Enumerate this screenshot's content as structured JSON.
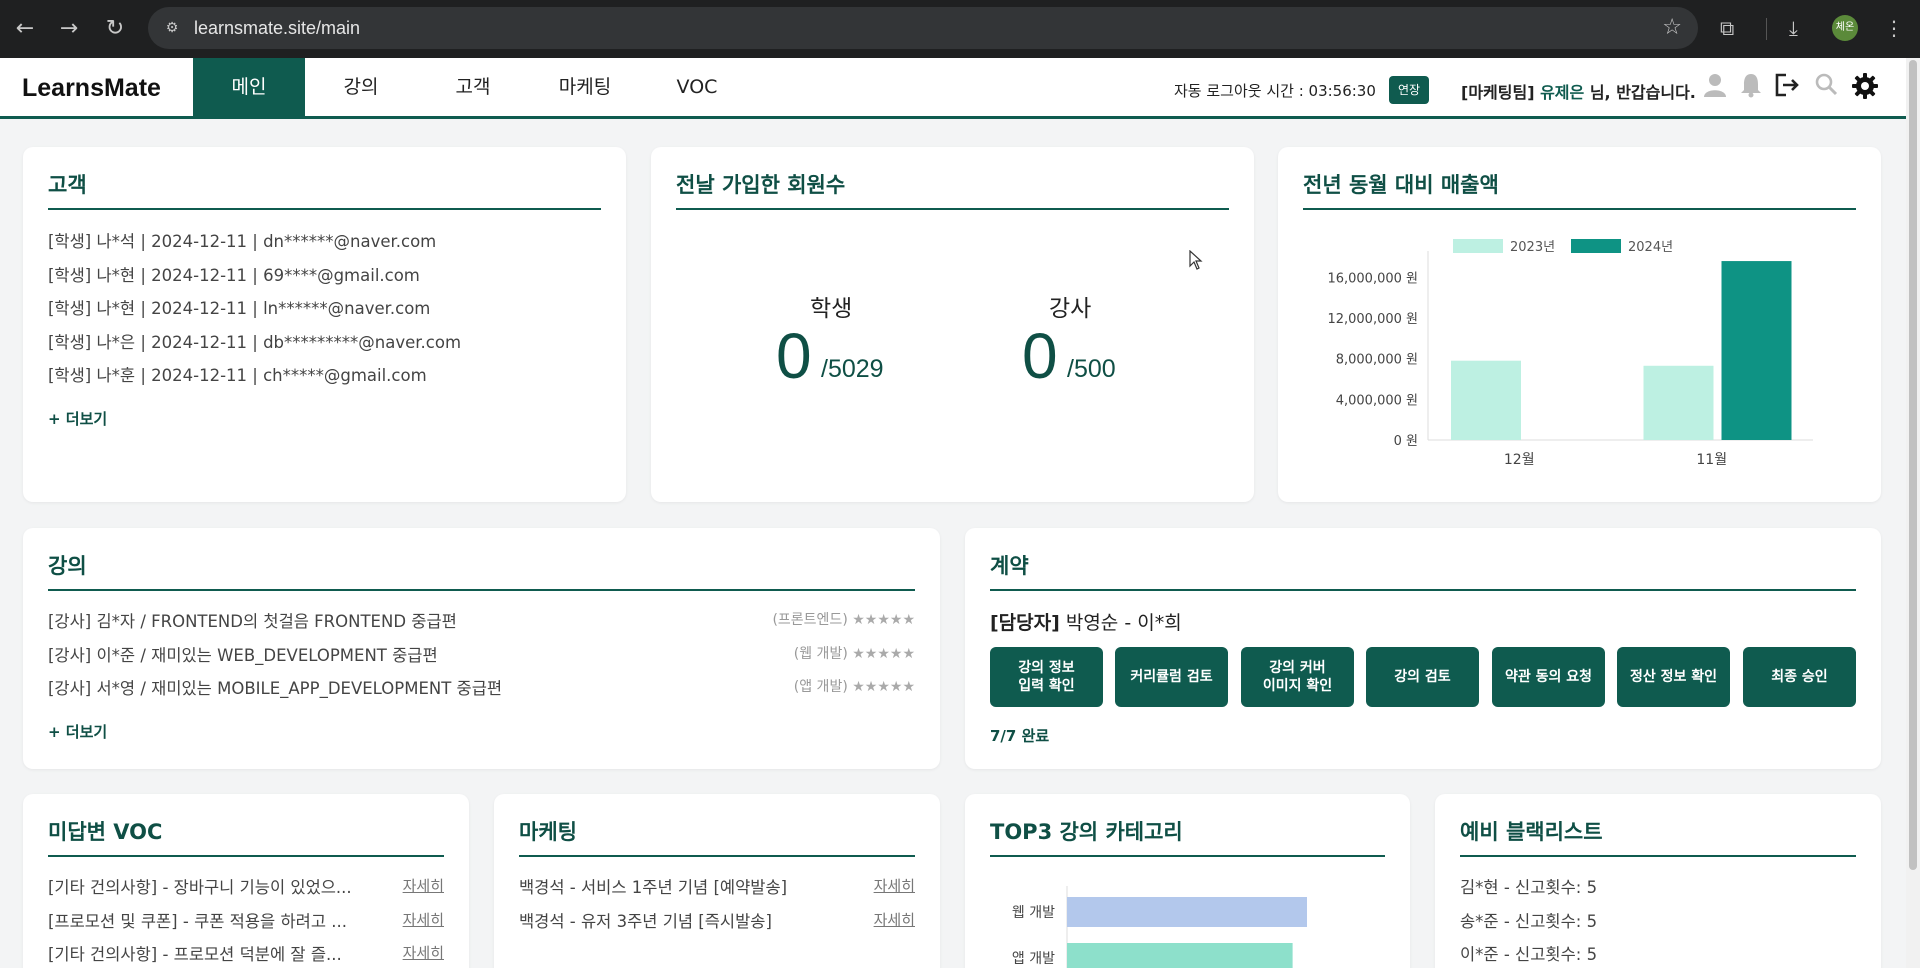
{
  "browser": {
    "url": "learnsmate.site/main",
    "profile_initials": "체온"
  },
  "app": {
    "logo": "LearnsMate",
    "nav": [
      "메인",
      "강의",
      "고객",
      "마케팅",
      "VOC"
    ],
    "logout_timer": "자동 로그아웃 시간 : 03:56:30",
    "extend_label": "연장",
    "greeting_team": "[마케팅팀] ",
    "greeting_name": "유제은",
    "greeting_suffix": " 님, 반갑습니다."
  },
  "customers": {
    "title": "고객",
    "rows": [
      "[학생]  나*석  |  2024-12-11  |  dn******@naver.com",
      "[학생]  나*현  |  2024-12-11  |  69****@gmail.com",
      "[학생]  나*현  |  2024-12-11  |  ln******@naver.com",
      "[학생]  나*은  |  2024-12-11  |  db*********@naver.com",
      "[학생]  나*훈  |  2024-12-11  |  ch*****@gmail.com"
    ],
    "more": "+ 더보기"
  },
  "signups": {
    "title": "전날 가입한 회원수",
    "student_label": "학생",
    "student_count": "0",
    "student_total": "/5029",
    "teacher_label": "강사",
    "teacher_count": "0",
    "teacher_total": "/500"
  },
  "sales": {
    "title": "전년 동월 대비 매출액"
  },
  "chart_data": [
    {
      "type": "bar",
      "categories": [
        "12월",
        "11월"
      ],
      "series": [
        {
          "name": "2023년",
          "values": [
            7800000,
            7300000
          ],
          "color": "#bdf0e2"
        },
        {
          "name": "2024년",
          "values": [
            0,
            17600000
          ],
          "color": "#0e9384"
        }
      ],
      "yticks": [
        "0 원",
        "4,000,000 원",
        "8,000,000 원",
        "12,000,000 원",
        "16,000,000 원"
      ],
      "ylim": [
        0,
        18000000
      ],
      "legend": "top"
    },
    {
      "type": "bar",
      "orientation": "horizontal",
      "categories": [
        "웹 개발",
        "앱 개발"
      ],
      "values": [
        100,
        94
      ],
      "colors": [
        "#b3c8ec",
        "#8de0cb"
      ]
    }
  ],
  "lectures": {
    "title": "강의",
    "rows": [
      {
        "text": "[강사] 김*자 / FRONTEND의 첫걸음 FRONTEND 중급편",
        "category": "(프론트엔드)",
        "stars": "★★★★★"
      },
      {
        "text": "[강사] 이*준 / 재미있는 WEB_DEVELOPMENT 중급편",
        "category": "(웹 개발)",
        "stars": "★★★★★"
      },
      {
        "text": "[강사] 서*영 / 재미있는 MOBILE_APP_DEVELOPMENT 중급편",
        "category": "(앱 개발)",
        "stars": "★★★★★"
      }
    ],
    "more": "+ 더보기"
  },
  "contract": {
    "title": "계약",
    "manager_label": "[담당자]",
    "manager_value": " 박영순 - 이*희",
    "steps": [
      "강의 정보\n입력 확인",
      "커리큘럼 검토",
      "강의 커버\n이미지 확인",
      "강의 검토",
      "약관 동의 요청",
      "정산 정보 확인",
      "최종 승인"
    ],
    "status": "7/7 완료"
  },
  "voc": {
    "title": "미답변 VOC",
    "rows": [
      "[기타 건의사항] - 장바구니 기능이 있었으...",
      "[프로모션 및 쿠폰] - 쿠폰 적용을 하려고 ...",
      "[기타 건의사항] - 프로모션 덕분에 잘 즐..."
    ],
    "detail": "자세히"
  },
  "marketing": {
    "title": "마케팅",
    "rows": [
      "백경석 - 서비스 1주년 기념 [예약발송]",
      "백경석 - 유저 3주년 기념 [즉시발송]"
    ],
    "detail": "자세히"
  },
  "top3": {
    "title": "TOP3 강의 카테고리"
  },
  "blacklist": {
    "title": "예비 블랙리스트",
    "rows": [
      "김*현 - 신고횟수: 5",
      "송*준 - 신고횟수: 5",
      "이*준 - 신고횟수: 5"
    ]
  }
}
